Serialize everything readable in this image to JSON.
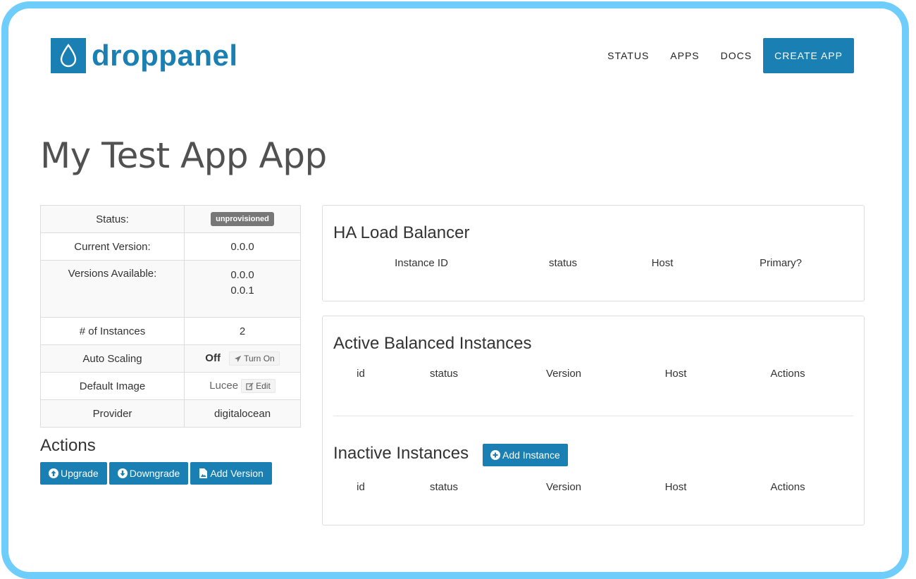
{
  "brand": {
    "name": "droppanel",
    "logo_icon": "water-drop-icon",
    "accent_color": "#1a7fb2",
    "frame_color": "#6fcdfb"
  },
  "nav": {
    "items": [
      "STATUS",
      "APPS",
      "DOCS"
    ],
    "create_label": "CREATE APP"
  },
  "page": {
    "title": "My Test App App"
  },
  "info": {
    "status_label": "Status:",
    "status_value": "unprovisioned",
    "current_version_label": "Current Version:",
    "current_version_value": "0.0.0",
    "versions_available_label": "Versions Available:",
    "versions_available": [
      "0.0.0",
      "0.0.1"
    ],
    "instances_label": "# of Instances",
    "instances_value": "2",
    "auto_scaling_label": "Auto Scaling",
    "auto_scaling_value": "Off",
    "turn_on_label": "Turn On",
    "default_image_label": "Default Image",
    "default_image_value": "Lucee",
    "edit_label": "Edit",
    "provider_label": "Provider",
    "provider_value": "digitalocean"
  },
  "actions": {
    "title": "Actions",
    "upgrade_label": "Upgrade",
    "downgrade_label": "Downgrade",
    "add_version_label": "Add Version"
  },
  "ha_panel": {
    "title": "HA Load Balancer",
    "columns": [
      "Instance ID",
      "status",
      "Host",
      "Primary?"
    ]
  },
  "active_panel": {
    "title": "Active Balanced Instances",
    "columns": [
      "id",
      "status",
      "Version",
      "Host",
      "Actions"
    ]
  },
  "inactive_panel": {
    "title": "Inactive Instances",
    "add_label": "Add Instance",
    "columns": [
      "id",
      "status",
      "Version",
      "Host",
      "Actions"
    ]
  }
}
